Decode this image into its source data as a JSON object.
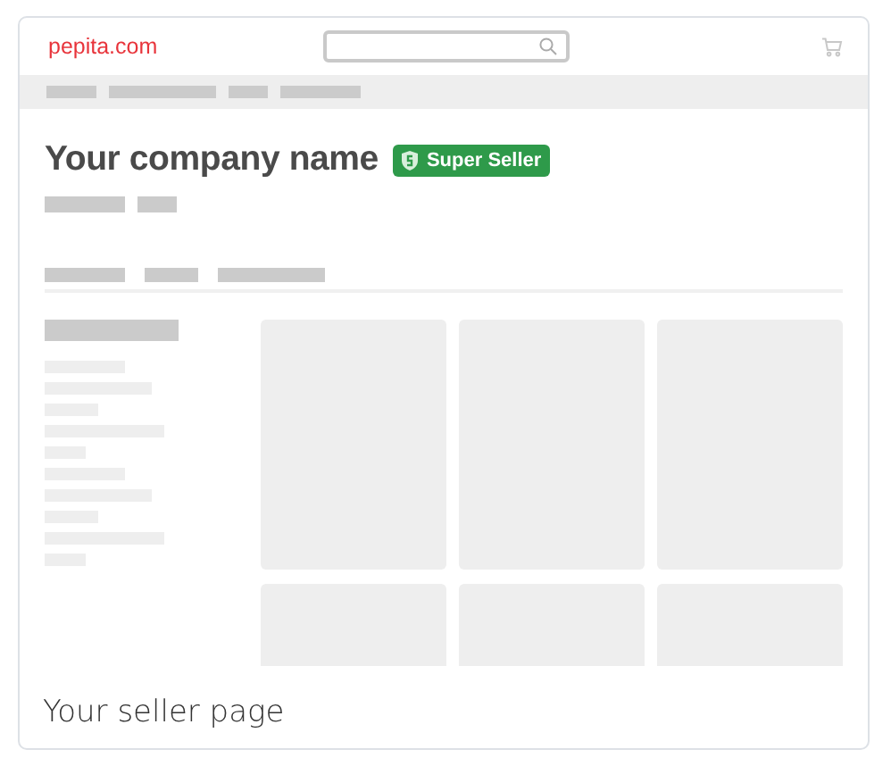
{
  "header": {
    "logo": "pepita.com"
  },
  "seller": {
    "name": "Your company name",
    "badge": "Super Seller"
  },
  "caption": "Your seller page"
}
